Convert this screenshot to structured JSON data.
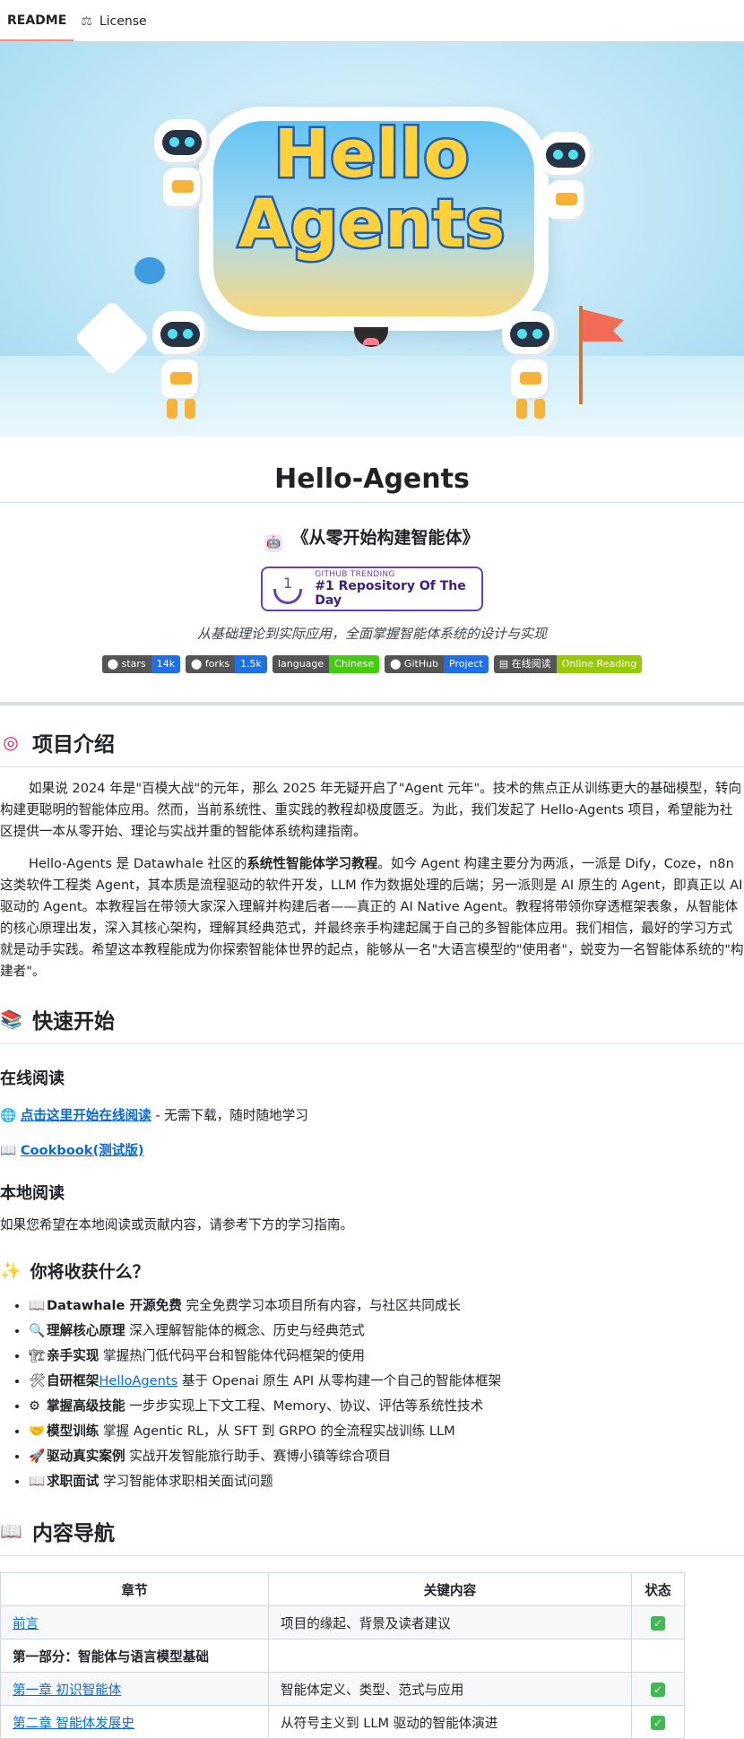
{
  "tabs": [
    {
      "label": "README",
      "icon": "readme-icon"
    },
    {
      "label": "License",
      "icon": "scale-icon"
    }
  ],
  "hero": {
    "line1": "Hello",
    "line2": "Agents"
  },
  "title": "Hello-Agents",
  "subtitle": "《从零开始构建智能体》",
  "trending": {
    "small": "GITHUB TRENDING",
    "big": "#1 Repository Of The Day",
    "rank": "1"
  },
  "tagline": "从基础理论到实际应用，全面掌握智能体系统的设计与实现",
  "badges": [
    {
      "left": "stars",
      "right": "14k",
      "color": "#1f6feb"
    },
    {
      "left": "forks",
      "right": "1.5k",
      "color": "#1f6feb"
    },
    {
      "left": "language",
      "right": "Chinese",
      "color": "#4c1"
    },
    {
      "left": "GitHub",
      "right": "Project",
      "color": "#1f6feb"
    },
    {
      "left": "在线阅读",
      "right": "Online Reading",
      "color": "#97ca00"
    }
  ],
  "intro": {
    "heading": "项目介绍",
    "p1": "如果说 2024 年是\"百模大战\"的元年，那么 2025 年无疑开启了\"Agent 元年\"。技术的焦点正从训练更大的基础模型，转向构建更聪明的智能体应用。然而，当前系统性、重实践的教程却极度匮乏。为此，我们发起了 Hello-Agents 项目，希望能为社区提供一本从零开始、理论与实战并重的智能体系统构建指南。",
    "p2_a": "Hello-Agents 是 Datawhale 社区的",
    "p2_bold": "系统性智能体学习教程",
    "p2_b": "。如今 Agent 构建主要分为两派，一派是 Dify，Coze，n8n 这类软件工程类 Agent，其本质是流程驱动的软件开发，LLM 作为数据处理的后端；另一派则是 AI 原生的 Agent，即真正以 AI 驱动的 Agent。本教程旨在带领大家深入理解并构建后者——真正的 AI Native Agent。教程将带领你穿透框架表象，从智能体的核心原理出发，深入其核心架构，理解其经典范式，并最终亲手构建起属于自己的多智能体应用。我们相信，最好的学习方式就是动手实践。希望这本教程能成为你探索智能体世界的起点，能够从一名\"大语言模型的\"使用者\"，蜕变为一名智能体系统的\"构建者\"。"
  },
  "quickstart": {
    "heading": "快速开始",
    "online_heading": "在线阅读",
    "online_link": "点击这里开始在线阅读",
    "online_suffix": " - 无需下载，随时随地学习",
    "cookbook_link": "Cookbook(测试版)",
    "local_heading": "本地阅读",
    "local_text": "如果您希望在本地阅读或贡献内容，请参考下方的学习指南。"
  },
  "gains": {
    "heading": "你将收获什么？",
    "items": [
      {
        "emoji": "📖",
        "bold": "Datawhale 开源免费",
        "text": " 完全免费学习本项目所有内容，与社区共同成长"
      },
      {
        "emoji": "🔍",
        "bold": "理解核心原理",
        "text": " 深入理解智能体的概念、历史与经典范式"
      },
      {
        "emoji": "🏗",
        "bold": "亲手实现",
        "text": " 掌握热门低代码平台和智能体代码框架的使用"
      },
      {
        "emoji": "🛠",
        "bold": "自研框架",
        "link": "HelloAgents",
        "text": " 基于 Openai 原生 API 从零构建一个自己的智能体框架"
      },
      {
        "emoji": "⚙",
        "bold": "掌握高级技能",
        "text": " 一步步实现上下文工程、Memory、协议、评估等系统性技术"
      },
      {
        "emoji": "🤝",
        "bold": "模型训练",
        "text": " 掌握 Agentic RL，从 SFT 到 GRPO 的全流程实战训练 LLM"
      },
      {
        "emoji": "🚀",
        "bold": "驱动真实案例",
        "text": " 实战开发智能旅行助手、赛博小镇等综合项目"
      },
      {
        "emoji": "📖",
        "bold": "求职面试",
        "text": " 学习智能体求职相关面试问题"
      }
    ]
  },
  "navigation": {
    "heading": "内容导航",
    "headers": [
      "章节",
      "关键内容",
      "状态"
    ],
    "rows": [
      {
        "chapter": "前言",
        "link": true,
        "content": "项目的缘起、背景及读者建议",
        "done": true
      },
      {
        "chapter": "第一部分：智能体与语言模型基础",
        "link": false,
        "bold": true,
        "content": "",
        "done": false
      },
      {
        "chapter": "第一章 初识智能体",
        "link": true,
        "content": "智能体定义、类型、范式与应用",
        "done": true
      },
      {
        "chapter": "第二章 智能体发展史",
        "link": true,
        "content": "从符号主义到 LLM 驱动的智能体演进",
        "done": true
      }
    ]
  }
}
